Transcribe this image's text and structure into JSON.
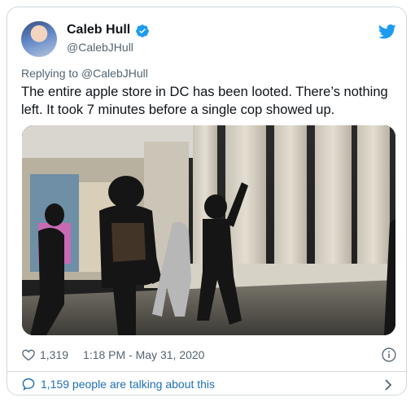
{
  "author": {
    "name": "Caleb Hull",
    "handle": "@CalebJHull",
    "verified": true
  },
  "reply": {
    "prefix": "Replying to",
    "to": "@CalebJHull"
  },
  "tweet": {
    "text": "The entire apple store in DC has been looted. There’s nothing left. It took 7 minutes before a single cop showed up.",
    "likes": "1,319",
    "timestamp": "1:18 PM - May 31, 2020"
  },
  "conversation": {
    "label": "1,159 people are talking about this"
  },
  "colors": {
    "brand": "#1d9bf0",
    "link": "#1d6fb8"
  },
  "icons": [
    "verified-icon",
    "twitter-bird-icon",
    "heart-icon",
    "info-icon",
    "speech-bubble-icon",
    "chevron-right-icon"
  ]
}
